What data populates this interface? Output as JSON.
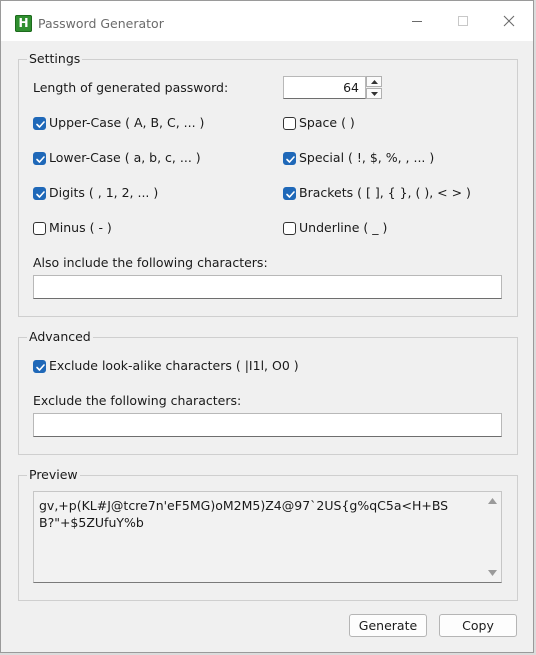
{
  "window": {
    "title": "Password Generator",
    "icon_letter": "H"
  },
  "settings": {
    "group_title": "Settings",
    "length_label": "Length of generated password:",
    "length_value": "64",
    "options": {
      "upper": {
        "label": "Upper-Case ( A, B, C, ... )",
        "checked": true
      },
      "space": {
        "label": "Space (   )",
        "checked": false
      },
      "lower": {
        "label": "Lower-Case ( a, b, c, ... )",
        "checked": true
      },
      "special": {
        "label": "Special ( !, $, %, , ... )",
        "checked": true
      },
      "digits": {
        "label": "Digits ( , 1, 2, ... )",
        "checked": true
      },
      "brackets": {
        "label": "Brackets ( [ ], { }, ( ), < > )",
        "checked": true
      },
      "minus": {
        "label": "Minus ( - )",
        "checked": false
      },
      "underline": {
        "label": "Underline ( _ )",
        "checked": false
      }
    },
    "include_label": "Also include the following characters:",
    "include_value": ""
  },
  "advanced": {
    "group_title": "Advanced",
    "exclude_lookalike": {
      "label": "Exclude look-alike characters ( |I1l, O0 )",
      "checked": true
    },
    "exclude_label": "Exclude the following characters:",
    "exclude_value": ""
  },
  "preview": {
    "group_title": "Preview",
    "text": "gv,+p(KL#J@tcre7n'eF5MG)oM2M5)Z4@97`2US{g%qC5a<H+BSB?\"+$5ZUfuY%b"
  },
  "buttons": {
    "generate": "Generate",
    "copy": "Copy"
  },
  "colors": {
    "accent": "#1f68b8",
    "icon_green": "#2f8f2f"
  }
}
